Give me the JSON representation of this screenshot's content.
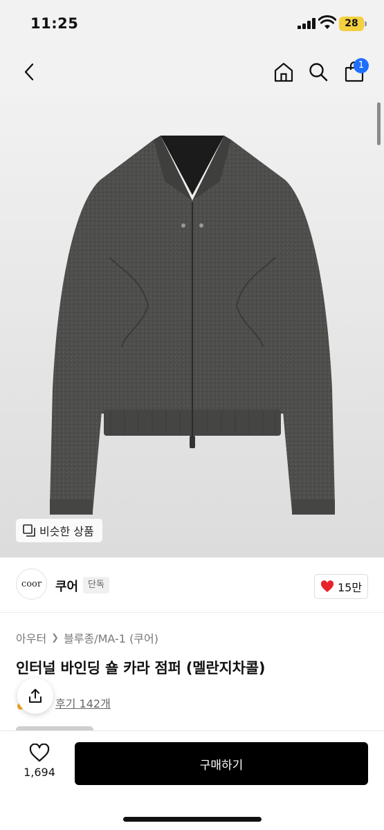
{
  "status_bar": {
    "time": "11:25",
    "battery": "28"
  },
  "nav": {
    "cart_count": "1"
  },
  "hero": {
    "similar_label": "비슷한 상품"
  },
  "brand": {
    "logo_text": "coor",
    "name": "쿠어",
    "badge": "단독",
    "likes": "15만"
  },
  "breadcrumb": {
    "items": [
      "아우터",
      "블루종/MA-1 (쿠어)"
    ]
  },
  "product": {
    "title": "인터널 바인딩 숄 카라 점퍼 (멜란지차콜)",
    "review_link": "후기 142개"
  },
  "bottom": {
    "wish_count": "1,694",
    "buy_label": "구매하기"
  },
  "colors": {
    "accent_blue": "#1f6fff",
    "heart_red": "#e8222b",
    "battery_yellow": "#f4cf3f",
    "buy_black": "#000000"
  },
  "icons": [
    "back-icon",
    "home-icon",
    "search-icon",
    "cart-icon",
    "similar-icon",
    "heart-icon",
    "share-icon",
    "heart-outline-icon"
  ]
}
